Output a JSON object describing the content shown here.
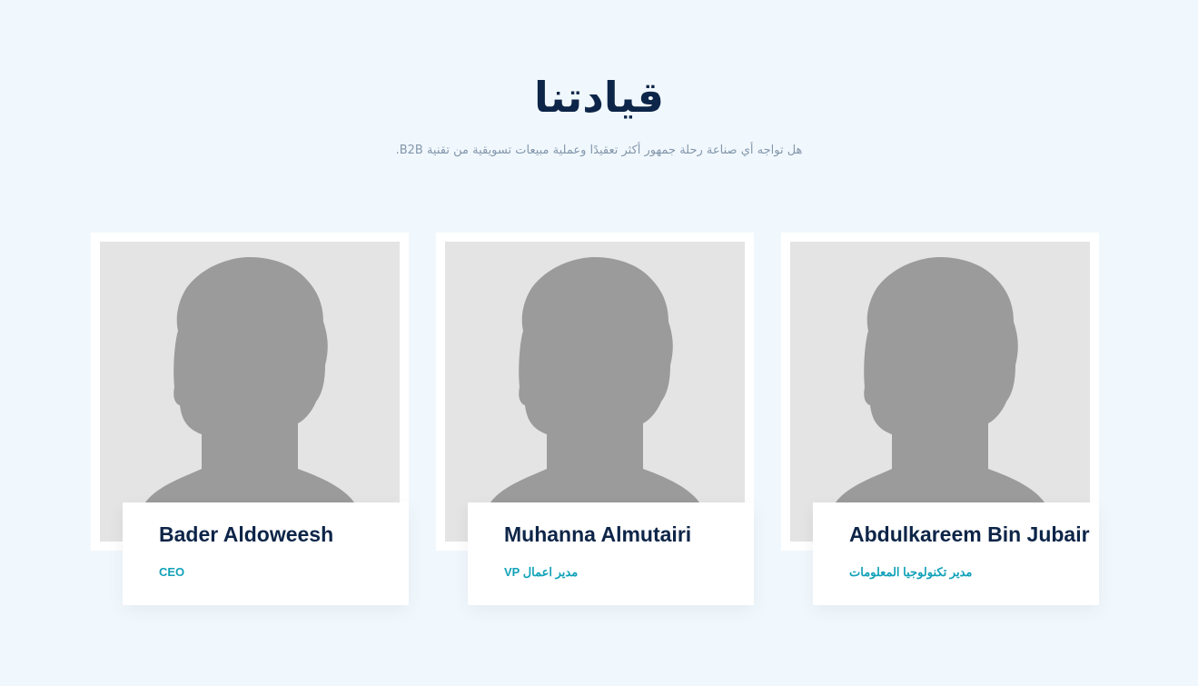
{
  "section": {
    "title": "قيادتنا",
    "subtitle": "هل تواجه أي صناعة رحلة جمهور أكثر تعقيدًا وعملية مبيعات تسويقية من تقنية B2B."
  },
  "team": [
    {
      "name": "Bader Aldoweesh",
      "role": "CEO",
      "photo_icon": "avatar-placeholder-icon"
    },
    {
      "name": "Muhanna Almutairi",
      "role": "VP مدير اعمال",
      "photo_icon": "avatar-placeholder-icon"
    },
    {
      "name": "Abdulkareem Bin Jubair",
      "role": "مدير تكنولوجيا المعلومات",
      "photo_icon": "avatar-placeholder-icon"
    }
  ],
  "colors": {
    "background": "#f1f8fd",
    "title": "#0d2548",
    "subtitle": "#8396ab",
    "role_accent": "#12a2b8",
    "photo_bg": "#e4e4e4",
    "silhouette": "#9b9b9b"
  }
}
